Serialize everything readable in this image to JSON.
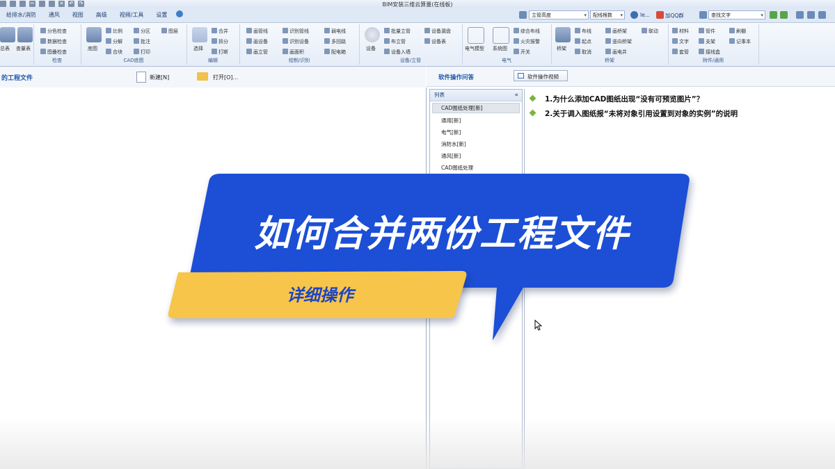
{
  "app_title": "BIM安装三维云算量(在线板)",
  "menu": [
    "给排水/消防",
    "通风",
    "视图",
    "高级",
    "视频/工具",
    "设置"
  ],
  "toolbar": {
    "combo1": "立管高度",
    "combo2": "配线根数",
    "user": "le...",
    "qq": "加QQ群",
    "search": "查找文字"
  },
  "ribbon": {
    "g1": {
      "items": [
        "总表",
        "查量表"
      ]
    },
    "g2": {
      "name": "检查",
      "items": [
        "分色检查",
        "数据检查",
        "图叠检查"
      ]
    },
    "g3": {
      "name": "CAD底图",
      "big": "底图",
      "items": [
        "比例",
        "分区",
        "图层",
        "分解",
        "批注",
        "合块",
        "打印"
      ]
    },
    "g4": {
      "name": "编辑",
      "big": "选择",
      "items": [
        "合并",
        "拆分",
        "打断"
      ]
    },
    "g5": {
      "name": "绘制/识别",
      "items": [
        "画管线",
        "画设备",
        "画立管",
        "识别管线",
        "识别设备",
        "画面积",
        "弱电线",
        "多回路",
        "配电箱"
      ]
    },
    "g6": {
      "name": "设备/立管",
      "big": "设备",
      "items": [
        "批量立管",
        "布立管",
        "设备入墙",
        "设备漏盘",
        "设备表"
      ]
    },
    "g7": {
      "name": "电气",
      "items": [
        "电气模型",
        "系统图",
        "综合布线",
        "火灾报警",
        "开关"
      ]
    },
    "g8": {
      "name": "桥架",
      "big": "桥架",
      "items": [
        "布线",
        "起点",
        "取消",
        "画桥架",
        "竖向桥架",
        "画电井",
        "联动"
      ]
    },
    "g9": {
      "name": "附件/通用",
      "items": [
        "材料",
        "文字",
        "套管",
        "管件",
        "支架",
        "接线盒",
        "刷棚",
        "记事本"
      ]
    }
  },
  "left_pane": {
    "title": "的工程文件",
    "new_label": "新建[N]",
    "open_label": "打开[O]..."
  },
  "right_pane": {
    "title": "软件操作问答",
    "video_button": "软件操作视频",
    "list_title": "列表",
    "list_items": [
      "CAD图纸处理[新]",
      "通用[新]",
      "电气[新]",
      "消防水[新]",
      "通风[新]",
      "CAD图纸处理"
    ],
    "questions": [
      "1.为什么添加CAD图纸出现“没有可预览图片”？",
      "2.关于调入图纸报“未将对象引用设置到对象的实例”的说明"
    ]
  },
  "banner": {
    "title": "如何合并两份工程文件",
    "subtitle": "详细操作"
  },
  "colors": {
    "banner_blue": "#1f4fd6",
    "banner_yellow": "#f6c548",
    "accent": "#1d3e73"
  }
}
